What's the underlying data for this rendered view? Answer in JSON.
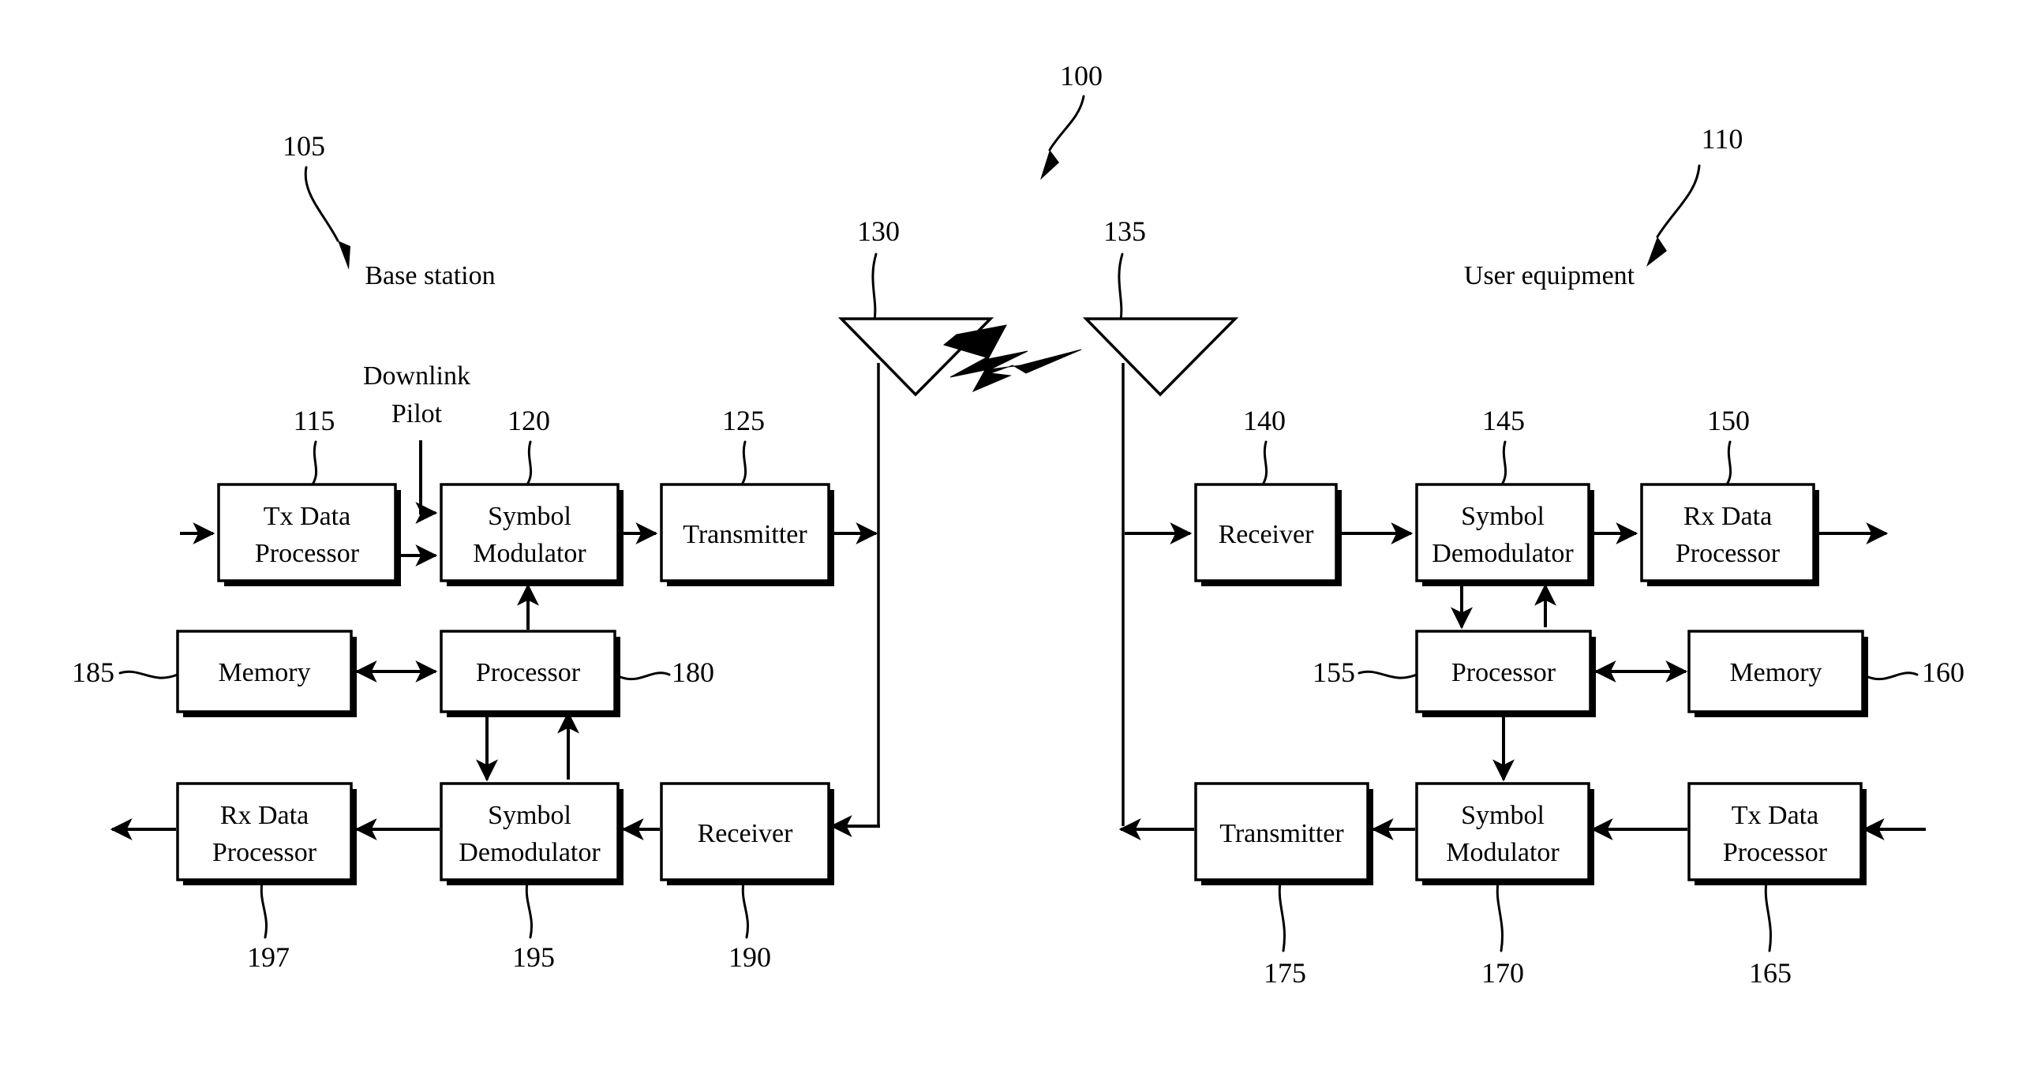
{
  "figure": {
    "system_ref": "100",
    "left_side": {
      "title": "Base station",
      "ref": "105"
    },
    "right_side": {
      "title": "User equipment",
      "ref": "110"
    },
    "pilot_label_line1": "Downlink",
    "pilot_label_line2": "Pilot",
    "antennas": [
      {
        "name": "base-station-antenna",
        "ref": "130"
      },
      {
        "name": "user-equipment-antenna",
        "ref": "135"
      }
    ],
    "blocks": [
      {
        "id": "tx-data-processor-bs",
        "line1": "Tx Data",
        "line2": "Processor",
        "ref": "115"
      },
      {
        "id": "symbol-modulator-bs",
        "line1": "Symbol",
        "line2": "Modulator",
        "ref": "120"
      },
      {
        "id": "transmitter-bs",
        "line1": "Transmitter",
        "line2": "",
        "ref": "125"
      },
      {
        "id": "memory-bs",
        "line1": "Memory",
        "line2": "",
        "ref": "185"
      },
      {
        "id": "processor-bs",
        "line1": "Processor",
        "line2": "",
        "ref": "180"
      },
      {
        "id": "rx-data-processor-bs",
        "line1": "Rx Data",
        "line2": "Processor",
        "ref": "197"
      },
      {
        "id": "symbol-demodulator-bs",
        "line1": "Symbol",
        "line2": "Demodulator",
        "ref": "195"
      },
      {
        "id": "receiver-bs",
        "line1": "Receiver",
        "line2": "",
        "ref": "190"
      },
      {
        "id": "receiver-ue",
        "line1": "Receiver",
        "line2": "",
        "ref": "140"
      },
      {
        "id": "symbol-demodulator-ue",
        "line1": "Symbol",
        "line2": "Demodulator",
        "ref": "145"
      },
      {
        "id": "rx-data-processor-ue",
        "line1": "Rx Data",
        "line2": "Processor",
        "ref": "150"
      },
      {
        "id": "processor-ue",
        "line1": "Processor",
        "line2": "",
        "ref": "155"
      },
      {
        "id": "memory-ue",
        "line1": "Memory",
        "line2": "",
        "ref": "160"
      },
      {
        "id": "transmitter-ue",
        "line1": "Transmitter",
        "line2": "",
        "ref": "175"
      },
      {
        "id": "symbol-modulator-ue",
        "line1": "Symbol",
        "line2": "Modulator",
        "ref": "170"
      },
      {
        "id": "tx-data-processor-ue",
        "line1": "Tx Data",
        "line2": "Processor",
        "ref": "165"
      }
    ]
  }
}
